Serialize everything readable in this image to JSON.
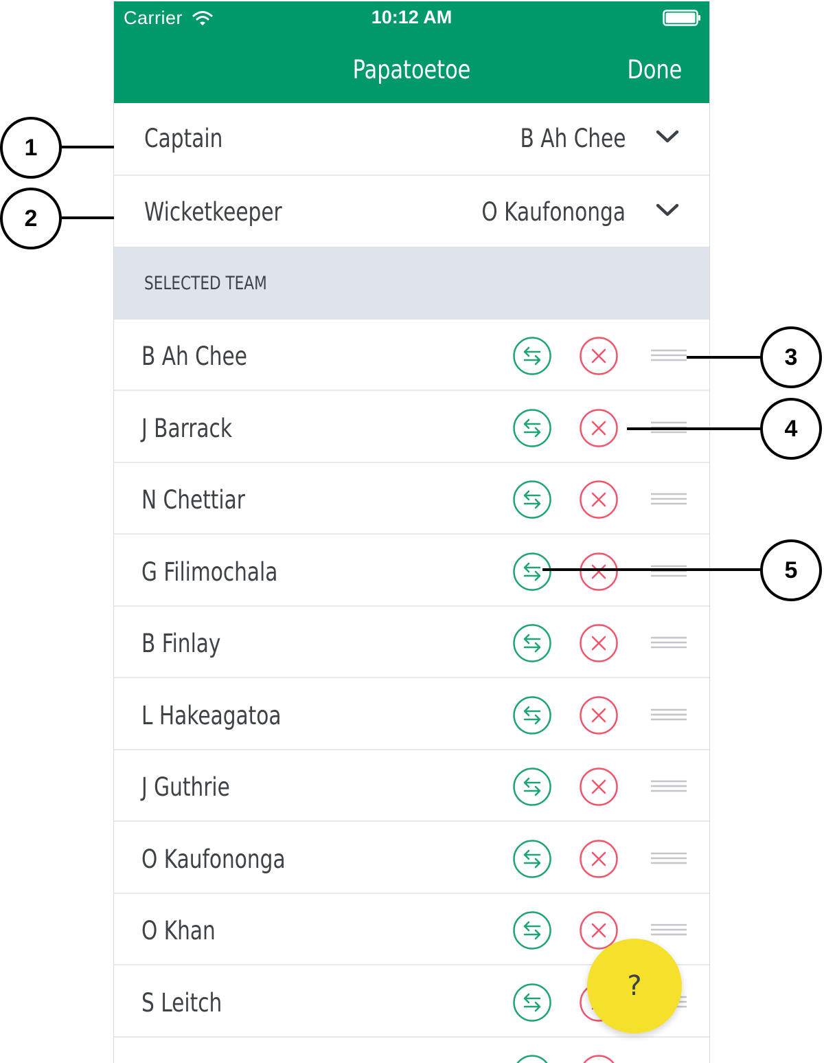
{
  "status_bar": {
    "carrier": "Carrier",
    "time": "10:12 AM"
  },
  "nav": {
    "title": "Papatoetoe",
    "done_label": "Done"
  },
  "captain": {
    "label": "Captain",
    "value": "B Ah Chee"
  },
  "wicketkeeper": {
    "label": "Wicketkeeper",
    "value": "O Kaufononga"
  },
  "section": {
    "label": "SELECTED TEAM"
  },
  "players": [
    "B Ah Chee",
    "J Barrack",
    "N Chettiar",
    "G Filimochala",
    "B Finlay",
    "L Hakeagatoa",
    "J Guthrie",
    "O Kaufononga",
    "O Khan",
    "S Leitch",
    ""
  ],
  "help": {
    "label": "?"
  },
  "callouts": [
    "1",
    "2",
    "3",
    "4",
    "5"
  ],
  "colors": {
    "header": "#019969",
    "swap": "#1fa474",
    "remove": "#f2546c",
    "section": "#dfe4ec",
    "help": "#f5e12b"
  }
}
